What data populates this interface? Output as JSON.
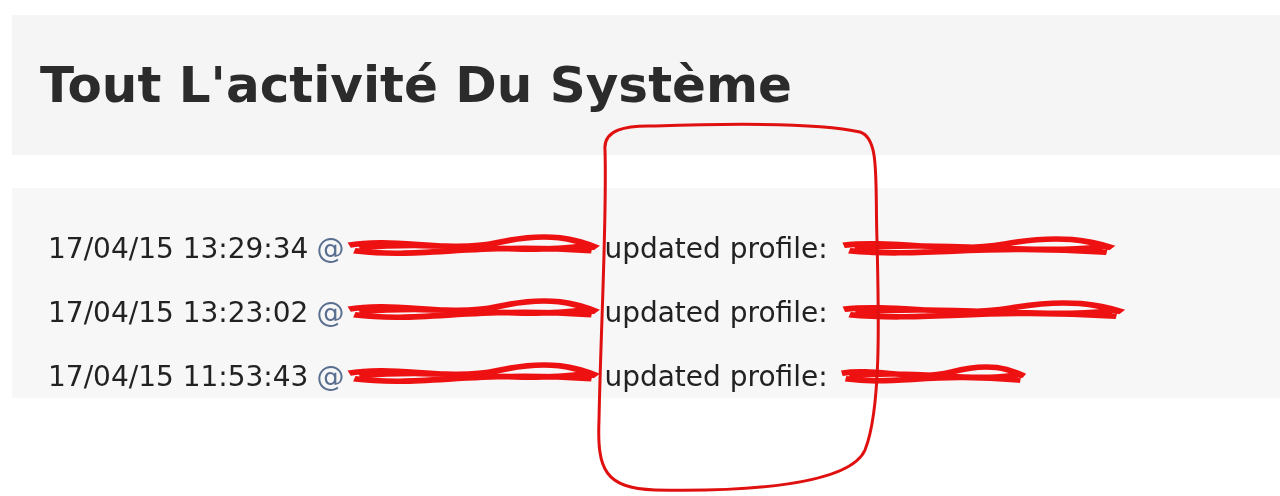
{
  "title": "Tout L'activité Du Système",
  "activity": [
    {
      "time": "17/04/15 13:29:34",
      "handle": "@",
      "action": "updated profile:"
    },
    {
      "time": "17/04/15 13:23:02",
      "handle": "@",
      "action": "updated profile:"
    },
    {
      "time": "17/04/15 11:53:43",
      "handle": "@",
      "action": "updated profile:"
    }
  ]
}
